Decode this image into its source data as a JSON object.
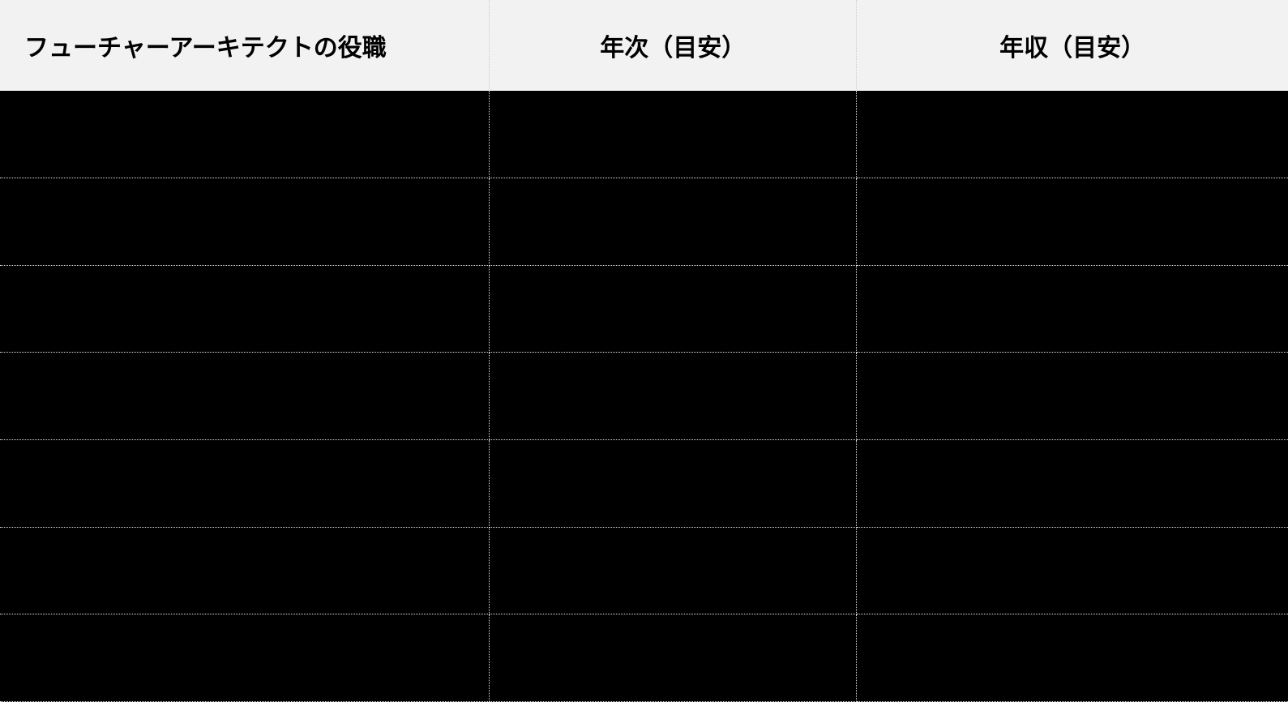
{
  "table": {
    "headers": [
      "フューチャーアーキテクトの役職",
      "年次（目安）",
      "年収（目安）"
    ],
    "rows": [
      {
        "position": "",
        "years": "",
        "salary": ""
      },
      {
        "position": "",
        "years": "",
        "salary": ""
      },
      {
        "position": "",
        "years": "",
        "salary": ""
      },
      {
        "position": "",
        "years": "",
        "salary": ""
      },
      {
        "position": "",
        "years": "",
        "salary": ""
      },
      {
        "position": "",
        "years": "",
        "salary": ""
      },
      {
        "position": "",
        "years": "",
        "salary": ""
      }
    ]
  }
}
